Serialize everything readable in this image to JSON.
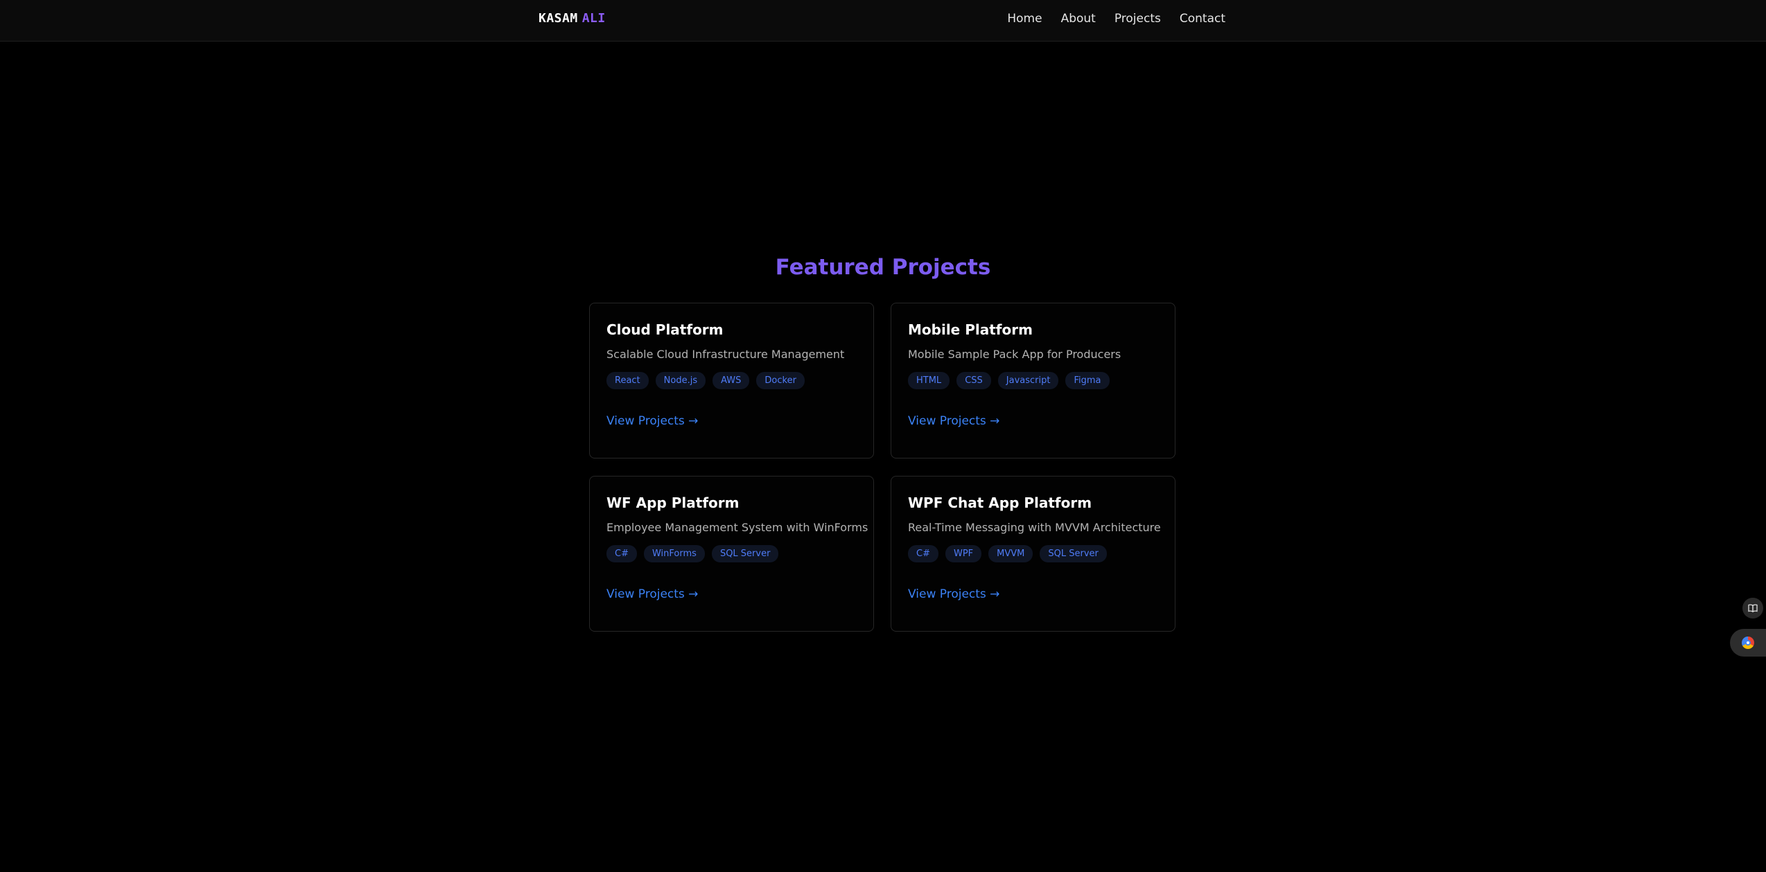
{
  "brand": {
    "first": "KASAM",
    "last": "ALI"
  },
  "nav": {
    "links": [
      "Home",
      "About",
      "Projects",
      "Contact"
    ]
  },
  "section": {
    "title": "Featured Projects"
  },
  "projects": [
    {
      "title": "Cloud Platform",
      "description": "Scalable Cloud Infrastructure Management",
      "tags": [
        "React",
        "Node.js",
        "AWS",
        "Docker"
      ],
      "link": "View Projects →"
    },
    {
      "title": "Mobile Platform",
      "description": "Mobile Sample Pack App for Producers",
      "tags": [
        "HTML",
        "CSS",
        "Javascript",
        "Figma"
      ],
      "link": "View Projects →"
    },
    {
      "title": "WF App Platform",
      "description": "Employee Management System with WinForms",
      "tags": [
        "C#",
        "WinForms",
        "SQL Server"
      ],
      "link": "View Projects →"
    },
    {
      "title": "WPF Chat App Platform",
      "description": "Real-Time Messaging with MVVM Architecture",
      "tags": [
        "C#",
        "WPF",
        "MVVM",
        "SQL Server"
      ],
      "link": "View Projects →"
    }
  ],
  "side_widgets": {
    "book_icon": "book-icon",
    "assistant_icon": "assistant-logo-icon"
  },
  "colors": {
    "accent": "#7c5cf0",
    "brand_accent": "#8b5cf6",
    "link": "#3b82f6",
    "tag_text": "#4f7cf7",
    "background": "#000000"
  }
}
